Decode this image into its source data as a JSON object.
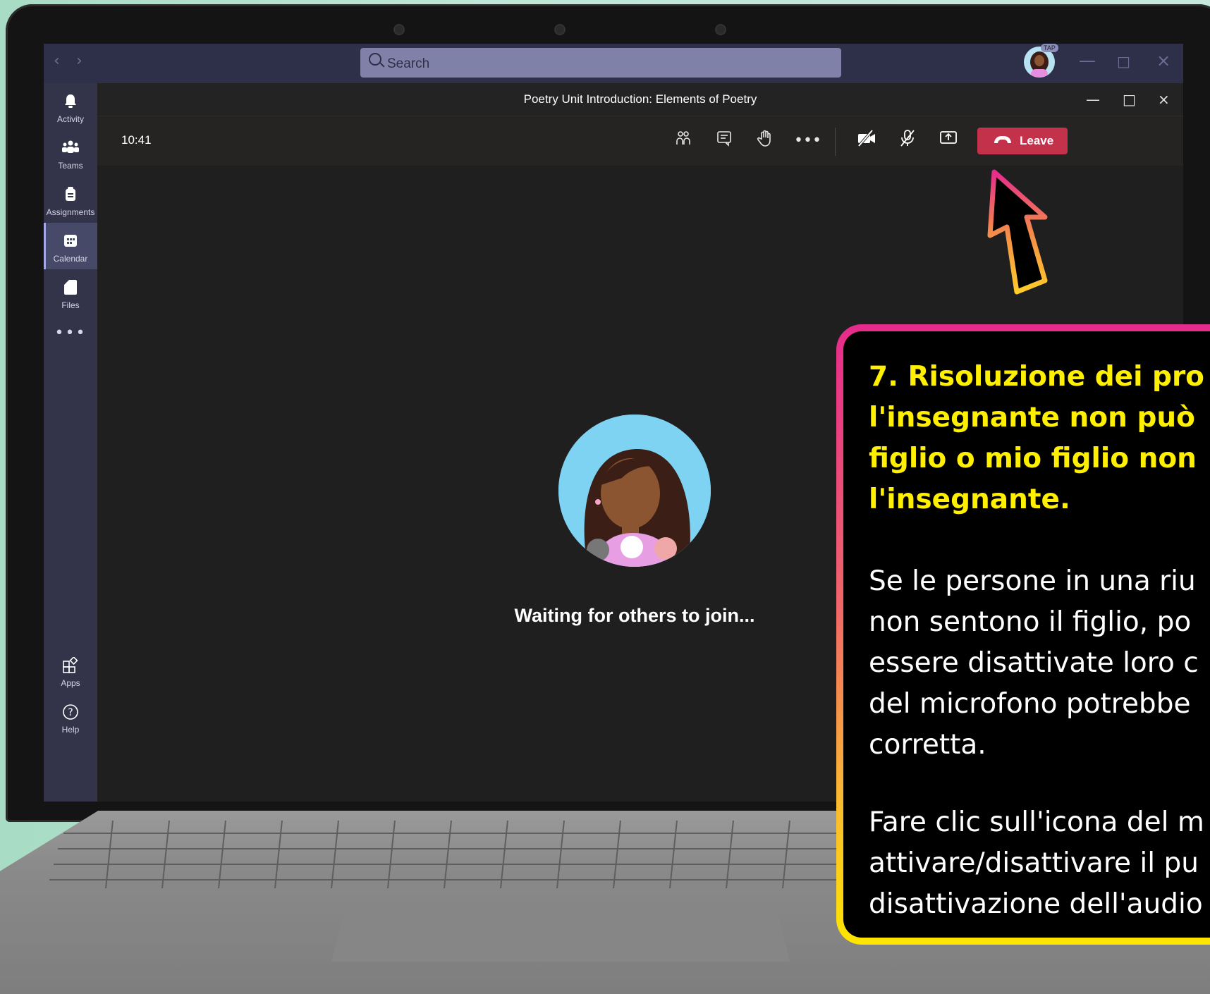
{
  "app": {
    "search_placeholder": "Search",
    "avatar_badge": "TAP"
  },
  "sidebar": {
    "items": [
      {
        "label": "Activity",
        "icon": "bell-icon"
      },
      {
        "label": "Teams",
        "icon": "teams-icon"
      },
      {
        "label": "Assignments",
        "icon": "assignments-icon"
      },
      {
        "label": "Calendar",
        "icon": "calendar-icon",
        "active": true
      },
      {
        "label": "Files",
        "icon": "file-icon"
      }
    ],
    "more": "•••",
    "bottom_items": [
      {
        "label": "Apps",
        "icon": "apps-icon"
      },
      {
        "label": "Help",
        "icon": "help-icon"
      }
    ]
  },
  "meeting": {
    "title": "Poetry Unit Introduction: Elements of Poetry",
    "clock": "10:41",
    "leave_label": "Leave",
    "waiting_text": "Waiting for others to join..."
  },
  "callout": {
    "title": "7. Risoluzione dei pro\nl'insegnante non può\nfiglio o mio figlio non\nl'insegnante.",
    "paragraph1": "Se le persone in una riu\nnon sentono il figlio, po\nessere disattivate loro c\ndel microfono potrebbe\ncorretta.",
    "paragraph2": "Fare clic sull'icona del m\nattivare/disattivare il pu\ndisattivazione dell'audio"
  },
  "colors": {
    "titlebar": "#2e3049",
    "sidebar": "#33344a",
    "leave_button": "#c4314b",
    "callout_title": "#ffef00",
    "callout_border_top": "#e52b8c",
    "callout_border_bottom": "#ffe600"
  }
}
